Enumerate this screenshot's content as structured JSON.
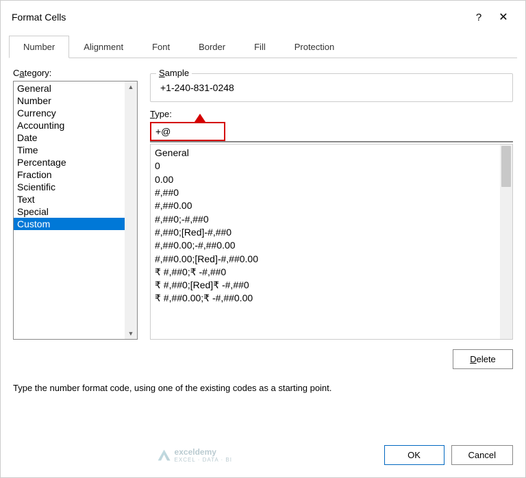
{
  "title": "Format Cells",
  "titlebar": {
    "help": "?",
    "close": "✕"
  },
  "tabs": [
    {
      "label": "Number",
      "active": true
    },
    {
      "label": "Alignment"
    },
    {
      "label": "Font"
    },
    {
      "label": "Border"
    },
    {
      "label": "Fill"
    },
    {
      "label": "Protection"
    }
  ],
  "category": {
    "label_pre": "C",
    "label_u": "a",
    "label_post": "tegory:",
    "items": [
      "General",
      "Number",
      "Currency",
      "Accounting",
      "Date",
      "Time",
      "Percentage",
      "Fraction",
      "Scientific",
      "Text",
      "Special",
      "Custom"
    ],
    "selected": "Custom"
  },
  "sample": {
    "label_u": "S",
    "label_post": "ample",
    "value": "+1-240-831-0248"
  },
  "type": {
    "label_u": "T",
    "label_post": "ype:",
    "value": "+@"
  },
  "formats": [
    "General",
    "0",
    "0.00",
    "#,##0",
    "#,##0.00",
    "#,##0;-#,##0",
    "#,##0;[Red]-#,##0",
    "#,##0.00;-#,##0.00",
    "#,##0.00;[Red]-#,##0.00",
    "₹ #,##0;₹ -#,##0",
    "₹ #,##0;[Red]₹ -#,##0",
    "₹ #,##0.00;₹ -#,##0.00"
  ],
  "buttons": {
    "delete_pre": "",
    "delete_u": "D",
    "delete_post": "elete",
    "ok": "OK",
    "cancel": "Cancel"
  },
  "description": "Type the number format code, using one of the existing codes as a starting point.",
  "watermark": {
    "name": "exceldemy",
    "sub": "EXCEL · DATA · BI"
  }
}
